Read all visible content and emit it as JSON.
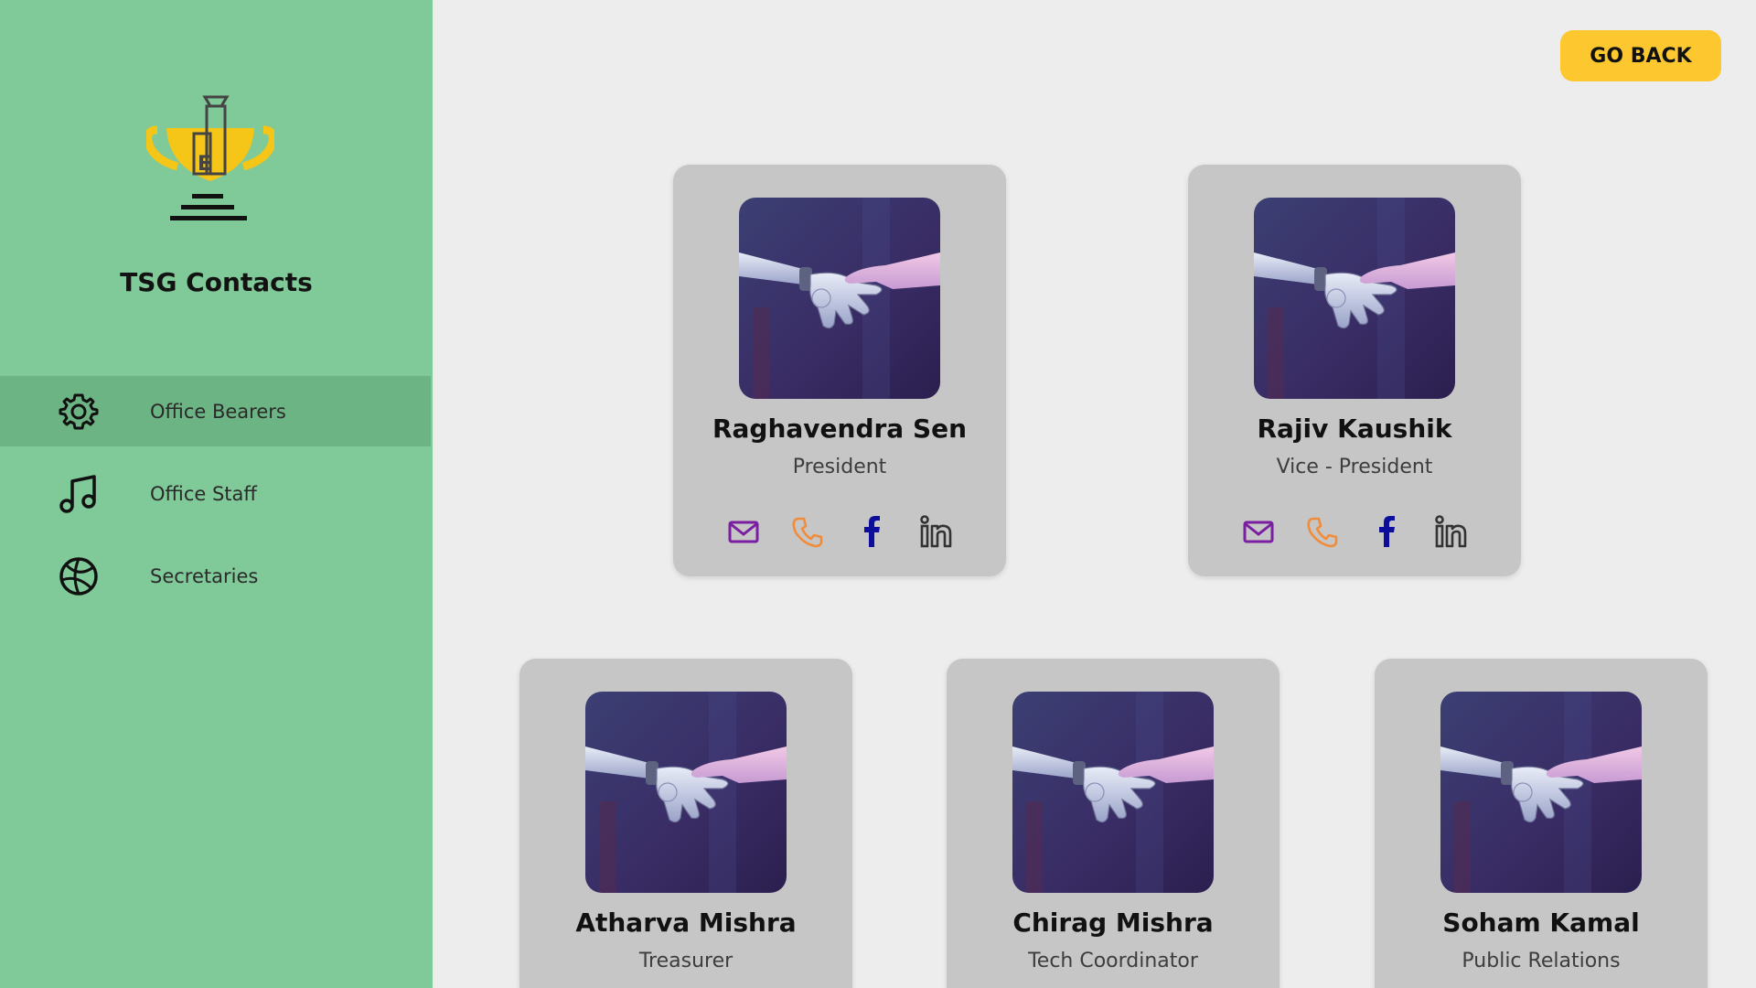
{
  "sidebar": {
    "title": "TSG Contacts",
    "items": [
      {
        "label": "Office Bearers",
        "icon": "gear-icon",
        "active": true
      },
      {
        "label": "Office Staff",
        "icon": "music-note-icon",
        "active": false
      },
      {
        "label": "Secretaries",
        "icon": "basketball-icon",
        "active": false
      }
    ]
  },
  "header": {
    "go_back_label": "GO BACK"
  },
  "cards": [
    {
      "name": "Raghavendra Sen",
      "role": "President"
    },
    {
      "name": "Rajiv Kaushik",
      "role": "Vice - President"
    },
    {
      "name": "Atharva Mishra",
      "role": "Treasurer"
    },
    {
      "name": "Chirag Mishra",
      "role": "Tech Coordinator"
    },
    {
      "name": "Soham Kamal",
      "role": "Public Relations"
    }
  ],
  "colors": {
    "sidebar_bg": "#80c998",
    "sidebar_active": "#6cb483",
    "button_accent": "#fdc82f",
    "card_bg": "#c6c6c6",
    "mail_icon": "#7a1fa2",
    "phone_icon": "#f08c3a",
    "facebook_icon": "#0d0f9c",
    "linkedin_icon": "#333333"
  }
}
